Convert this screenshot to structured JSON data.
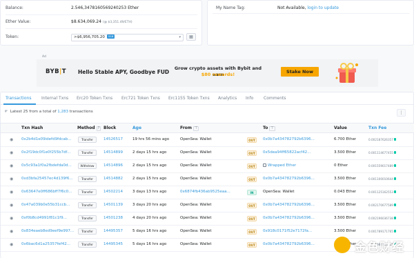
{
  "overview": {
    "balance_label": "Balance:",
    "balance_value": "2.546,3478160569240253 Ether",
    "ether_value_label": "Ether Value:",
    "ether_value": "$8.634,069.24",
    "ether_value_sub": "(@ $3,351.49/ETH)",
    "token_label": "Token:",
    "token_value": ">$6,956,705.20",
    "token_badge": "518"
  },
  "more_info": {
    "name_tag_label": "My Name Tag:",
    "name_tag_value": "Not Available,",
    "name_tag_link": "login to update"
  },
  "ad": {
    "label": "Ad",
    "logo_prefix": "BYB",
    "logo_suffix": "T",
    "headline": "Hello Stable APY, Goodbye FUD",
    "line1": "Grow crypto assets with Bybit and earn",
    "line2": "$80 rewards!",
    "button": "Stake Now",
    "accent": "#f7a600"
  },
  "tabs": [
    {
      "label": "Transactions",
      "active": true
    },
    {
      "label": "Internal Txns"
    },
    {
      "label": "Erc20 Token Txns"
    },
    {
      "label": "Erc721 Token Txns"
    },
    {
      "label": "Erc1155 Token Txns"
    },
    {
      "label": "Analytics"
    },
    {
      "label": "Info"
    },
    {
      "label": "Comments"
    }
  ],
  "summary": {
    "prefix": "Latest 25 from a total of",
    "count": "1,283",
    "suffix": "transactions"
  },
  "table": {
    "headers": {
      "txhash": "Txn Hash",
      "method": "Method",
      "block": "Block",
      "age": "Age",
      "from": "From",
      "to": "To",
      "value": "Value",
      "fee": "Txn Fee"
    },
    "rows": [
      {
        "hash": "0x2b4d1e09idefd9fdcab...",
        "method": "Transfer",
        "block": "14526517",
        "age": "19 hrs 56 mins ago",
        "from": "OpenSea: Wallet",
        "dir": "OUT",
        "to": "0x0b7a434782792b6396...",
        "to_contract": false,
        "value": "6.700 Ether",
        "fee": "0.002187626357"
      },
      {
        "hash": "0x2f19dc0f1e0f255b7df...",
        "method": "Transfer",
        "block": "14514899",
        "age": "2 days 15 hrs ago",
        "from": "OpenSea: Wallet",
        "dir": "OUT",
        "to": "0x5dea94ff65822acf42...",
        "to_contract": false,
        "value": "3.500 Ether",
        "fee": "0.001114677455"
      },
      {
        "hash": "0x5c93a1f0a2fbdefda0d...",
        "method": "Withdraw",
        "block": "14514896",
        "age": "2 days 15 hrs ago",
        "from": "OpenSea: Wallet",
        "dir": "OUT",
        "to": "Wrapped Ether",
        "to_contract": true,
        "value": "0 Ether",
        "fee": "0.001559017489"
      },
      {
        "hash": "0xd3bfa25457ec4d139f6...",
        "method": "Transfer",
        "block": "14514882",
        "age": "2 days 15 hrs ago",
        "from": "OpenSea: Wallet",
        "dir": "OUT",
        "to": "0x0b7a434782792b6396...",
        "to_contract": false,
        "value": "3.500 Ether",
        "fee": "0.001100010644"
      },
      {
        "hash": "0x63647e0ff686bff7f6c0...",
        "method": "Transfer",
        "block": "14502214",
        "age": "3 days 13 hrs ago",
        "from": "0x6874fb436ab9525eaa...",
        "dir": "IN",
        "to": "OpenSea: Wallet",
        "to_contract": false,
        "value": "0.043 Ether",
        "fee": "0.001125162553"
      },
      {
        "hash": "0x47a039b0e55b31ccb...",
        "method": "Transfer",
        "block": "14501139",
        "age": "3 days 20 hrs ago",
        "from": "OpenSea: Wallet",
        "dir": "OUT",
        "to": "0x0b7a434782792b6396...",
        "to_contract": false,
        "value": "3.500 Ether",
        "fee": "0.002170677589"
      },
      {
        "hash": "0xf0b8cd4991f81c1f9...",
        "method": "Transfer",
        "block": "14501238",
        "age": "4 days 20 hrs ago",
        "from": "OpenSea: Wallet",
        "dir": "OUT",
        "to": "0x0b7a434782792b6396...",
        "to_contract": false,
        "value": "3.500 Ether",
        "fee": "0.002196036738"
      },
      {
        "hash": "0x834eaeb8ed9eef9e997...",
        "method": "Transfer",
        "block": "14495357",
        "age": "5 days 16 hrs ago",
        "from": "OpenSea: Wallet",
        "dir": "OUT",
        "to": "0x918c0171f52e7172fa...",
        "to_contract": false,
        "value": "3.500 Ether",
        "fee": "0.001789171765"
      },
      {
        "hash": "0x6bac6d1a25357fef42...",
        "method": "Transfer",
        "block": "14495345",
        "age": "5 days 16 hrs ago",
        "from": "OpenSea: Wallet",
        "dir": "OUT",
        "to": "0x0b7a434782792b6396...",
        "to_contract": false,
        "value": "3.500 Ether",
        "fee": "0.001984219965"
      }
    ]
  },
  "watermark": {
    "text": "金色财经"
  },
  "colors": {
    "link": "#3498db",
    "out": "#b47d00",
    "in": "#00a186",
    "fee": "#00c9a7"
  }
}
